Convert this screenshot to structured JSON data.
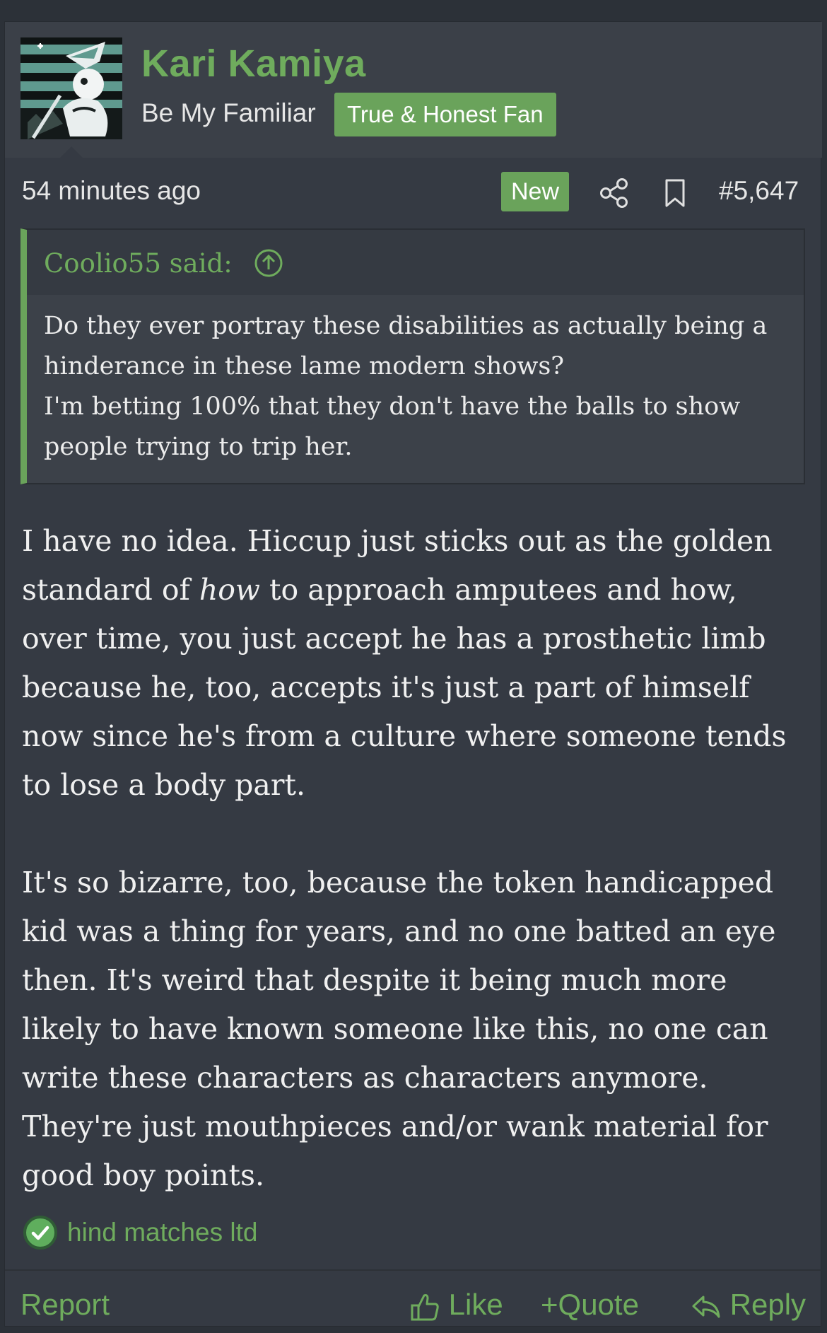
{
  "user": {
    "name": "Kari Kamiya",
    "title": "Be My Familiar",
    "banner": "True & Honest Fan"
  },
  "meta": {
    "time": "54 minutes ago",
    "new_badge": "New",
    "post_number": "#5,647",
    "icons": [
      "share-icon",
      "bookmark-icon"
    ]
  },
  "quote": {
    "author_label": "Coolio55 said:",
    "text": "Do they ever portray these disabilities as actually being a hinderance in these lame modern shows?\nI'm betting 100% that they don't have the balls to show people trying to trip her."
  },
  "message": {
    "p1_before": "I have no idea. Hiccup just sticks out as the golden standard of ",
    "p1_emphasis": "how",
    "p1_after": " to approach amputees and how, over time, you just accept he has a prosthetic limb because he, too, accepts it's just a part of himself now since he's from a culture where someone tends to lose a body part.",
    "p2": "It's so bizarre, too, because the token handicapped kid was a thing for years, and no one batted an eye then. It's weird that despite it being much more likely to have known someone like this, no one can write these characters as characters anymore. They're just mouthpieces and/or wank material for good boy points."
  },
  "reactions": {
    "summary": "hind matches ltd"
  },
  "footer": {
    "report": "Report",
    "like": "Like",
    "quote": "Quote",
    "reply": "Reply"
  },
  "colors": {
    "accent": "#6aa35b",
    "background": "#353a43",
    "header": "#3b4048"
  }
}
